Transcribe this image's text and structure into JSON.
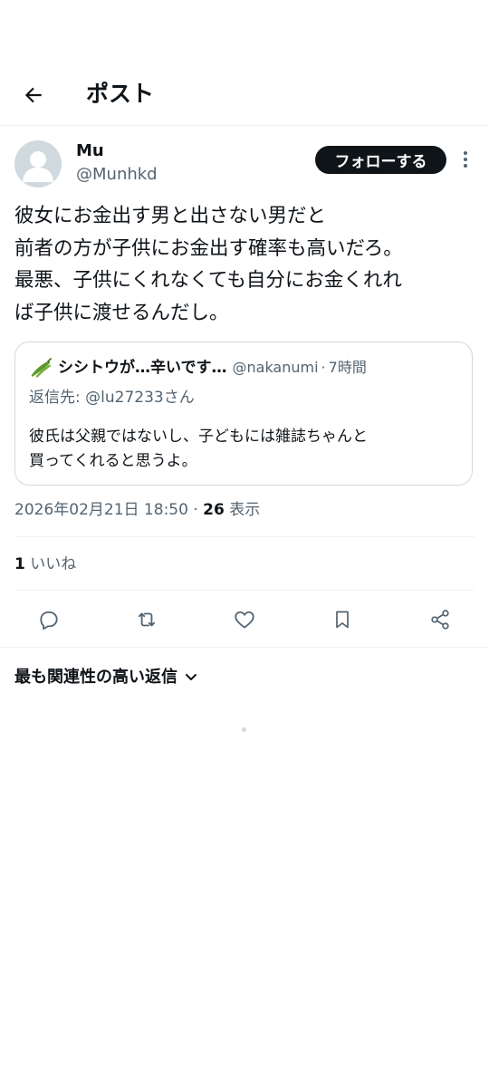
{
  "header": {
    "title": "ポスト",
    "back_icon": "arrow-left-icon"
  },
  "author": {
    "display_name": "Mu",
    "handle": "@Munhkd",
    "follow_label": "フォローする",
    "more_icon": "more-vertical-icon"
  },
  "tweet": {
    "lines": [
      "彼女にお金出す男と出さない男だと",
      "前者の方が子供にお金出す確率も高いだろ。",
      "最悪、子供にくれなくても自分にお金くれれ",
      "ば子供に渡せるんだし。"
    ]
  },
  "quote": {
    "emoji_icon": "green-pepper-icon",
    "name": "シシトウが…辛いです…",
    "handle": "@nakanumi",
    "separator": "·",
    "time": "7時間",
    "reply_to": "返信先: @lu27233さん",
    "body_lines": [
      "彼氏は父親ではないし、子どもには雑誌ちゃんと",
      "買ってくれると思うよ。"
    ]
  },
  "meta": {
    "timestamp": "2026年02月21日 18:50",
    "separator": "·",
    "views_count": "26",
    "views_label": "表示"
  },
  "stats": {
    "likes_count": "1",
    "likes_label": "いいね"
  },
  "actions": [
    "reply-icon",
    "retweet-icon",
    "heart-icon",
    "bookmark-icon",
    "share-icon"
  ],
  "replies": {
    "sort_label": "最も関連性の高い返信",
    "chevron_icon": "chevron-down-icon"
  },
  "colors": {
    "text": "#0f1419",
    "secondary": "#536471",
    "border": "#cfd9de",
    "divider": "#eff3f4",
    "follow_bg": "#0f1419"
  }
}
